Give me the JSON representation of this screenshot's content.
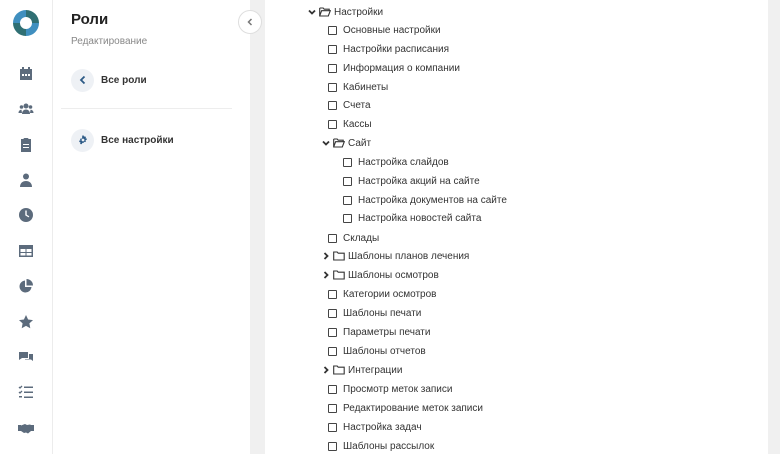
{
  "panel": {
    "title": "Роли",
    "subtitle": "Редактирование",
    "back_label": "Все роли",
    "settings_label": "Все настройки"
  },
  "sidebar_icons": [
    "calendar-icon",
    "users-icon",
    "clipboard-icon",
    "person-icon",
    "clock-icon",
    "table-icon",
    "pie-chart-icon",
    "star-icon",
    "chat-icon",
    "checklist-icon",
    "handshake-icon"
  ],
  "tree": {
    "root": "Настройки",
    "items": [
      "Основные настройки",
      "Настройки расписания",
      "Информация о компании",
      "Кабинеты",
      "Счета",
      "Кассы"
    ],
    "site_folder": "Сайт",
    "site_items": [
      "Настройка слайдов",
      "Настройка акций на сайте",
      "Настройка документов на сайте",
      "Настройка новостей сайта"
    ],
    "after_site": {
      "warehouses": "Склады",
      "treatment_plans_folder": "Шаблоны планов лечения",
      "exam_templates_folder": "Шаблоны осмотров",
      "exam_categories": "Категории осмотров",
      "print_templates": "Шаблоны печати",
      "print_params": "Параметры печати",
      "report_templates": "Шаблоны отчетов",
      "integrations_folder": "Интеграции",
      "view_tags": "Просмотр меток записи",
      "edit_tags": "Редактирование меток записи",
      "tasks": "Настройка задач",
      "mailing_templates": "Шаблоны рассылок"
    }
  }
}
